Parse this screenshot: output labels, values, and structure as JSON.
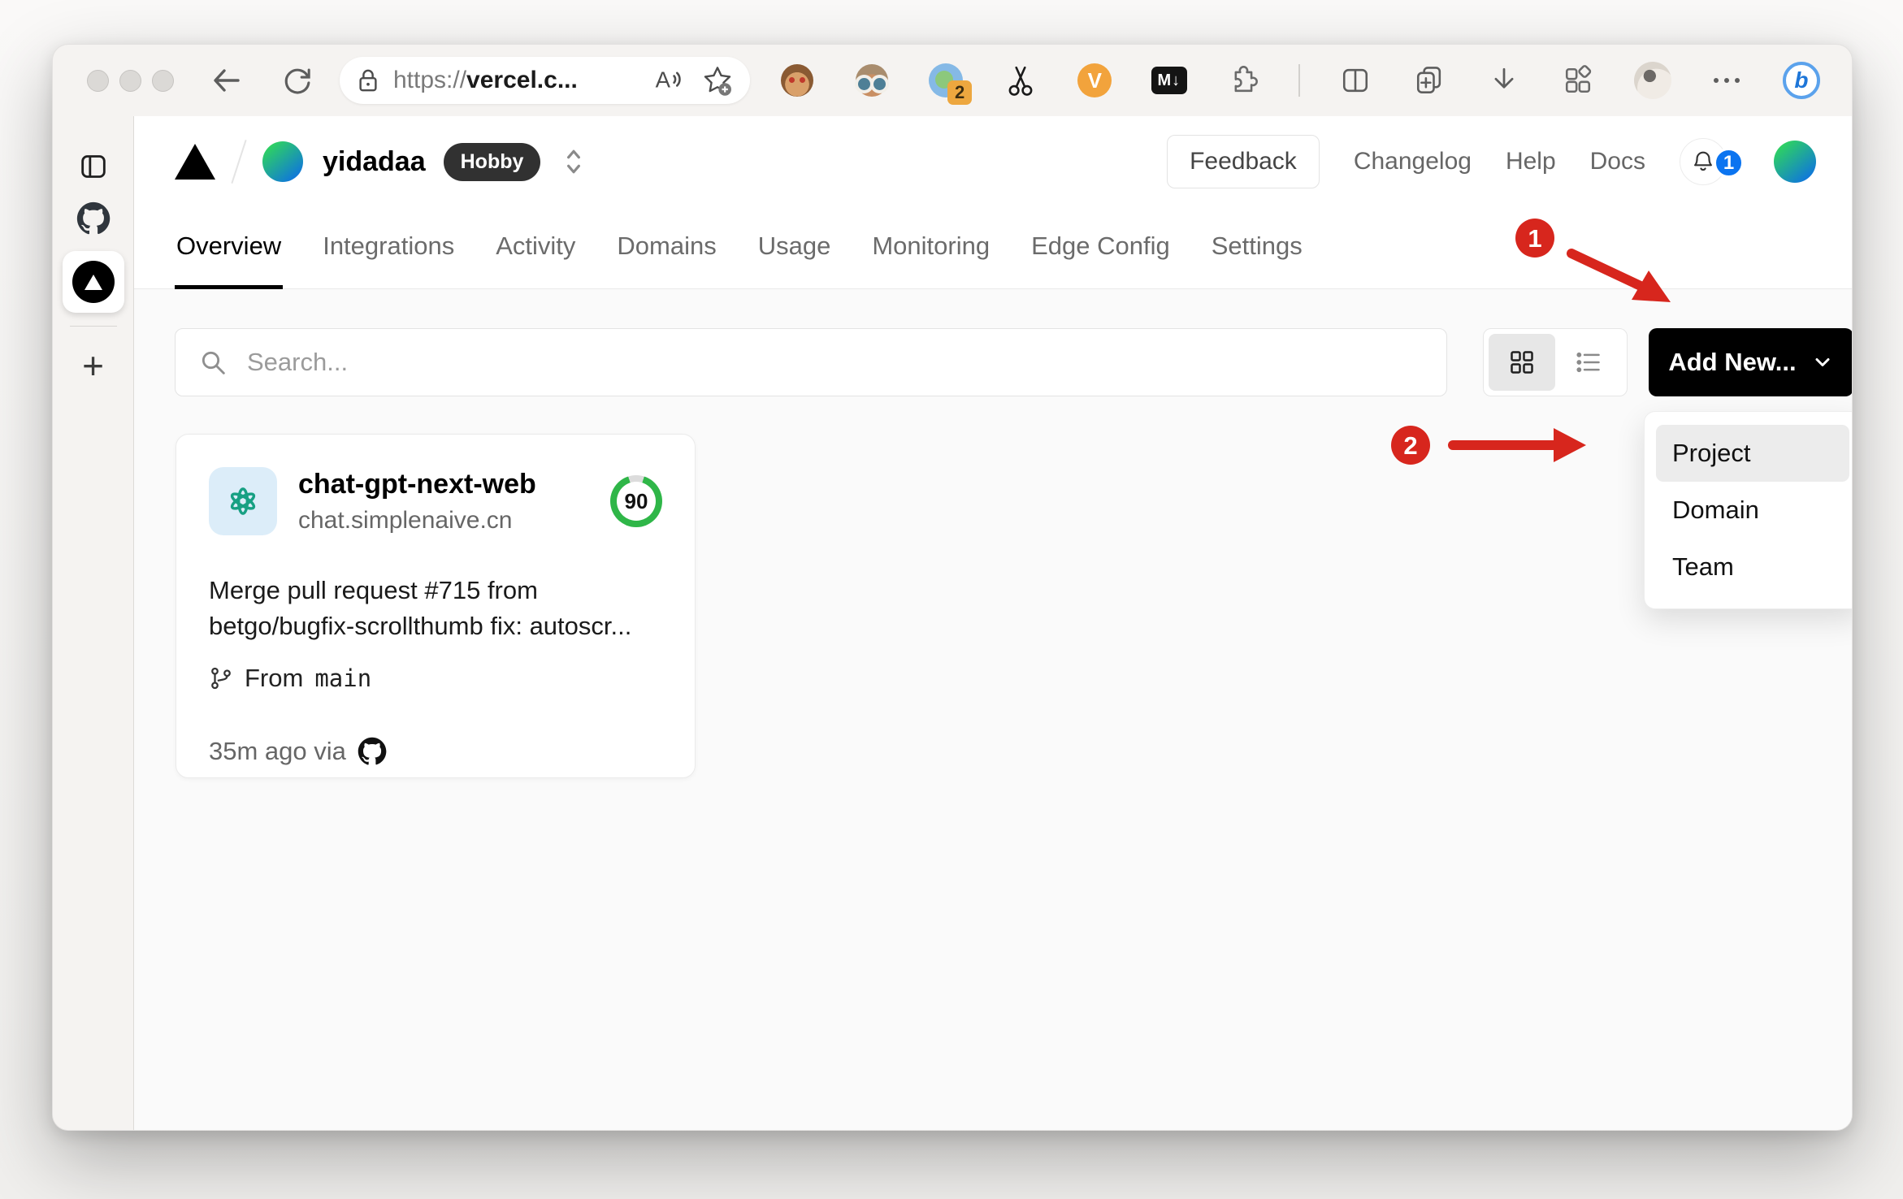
{
  "browser": {
    "url_scheme": "https://",
    "url_host": "vercel.c...",
    "extension_badge_count": "2",
    "video_ext_label": "V",
    "markdown_ext_label": "M↓",
    "copilot_label": "b"
  },
  "vercel": {
    "team_name": "yidadaa",
    "plan_badge": "Hobby",
    "nav_right": {
      "feedback": "Feedback",
      "changelog": "Changelog",
      "help": "Help",
      "docs": "Docs"
    },
    "notification_count": "1",
    "tabs": [
      {
        "label": "Overview"
      },
      {
        "label": "Integrations"
      },
      {
        "label": "Activity"
      },
      {
        "label": "Domains"
      },
      {
        "label": "Usage"
      },
      {
        "label": "Monitoring"
      },
      {
        "label": "Edge Config"
      },
      {
        "label": "Settings"
      }
    ],
    "controls": {
      "search_placeholder": "Search...",
      "add_new_label": "Add New..."
    },
    "dropdown": {
      "items": [
        {
          "label": "Project"
        },
        {
          "label": "Domain"
        },
        {
          "label": "Team"
        }
      ]
    },
    "project_card": {
      "name": "chat-gpt-next-web",
      "domain": "chat.simplenaive.cn",
      "score": "90",
      "commit_lines": [
        "Merge pull request #715 from",
        "betgo/bugfix-scrollthumb fix: autoscr..."
      ],
      "branch_label": "From",
      "branch_name": "main",
      "deploy_meta": "35m ago via"
    }
  },
  "annotations": {
    "step1": "1",
    "step2": "2"
  },
  "colors": {
    "annotation_red": "#d7261d",
    "score_green": "#2fb648",
    "notification_blue": "#0b74f0",
    "button_black": "#000000"
  }
}
